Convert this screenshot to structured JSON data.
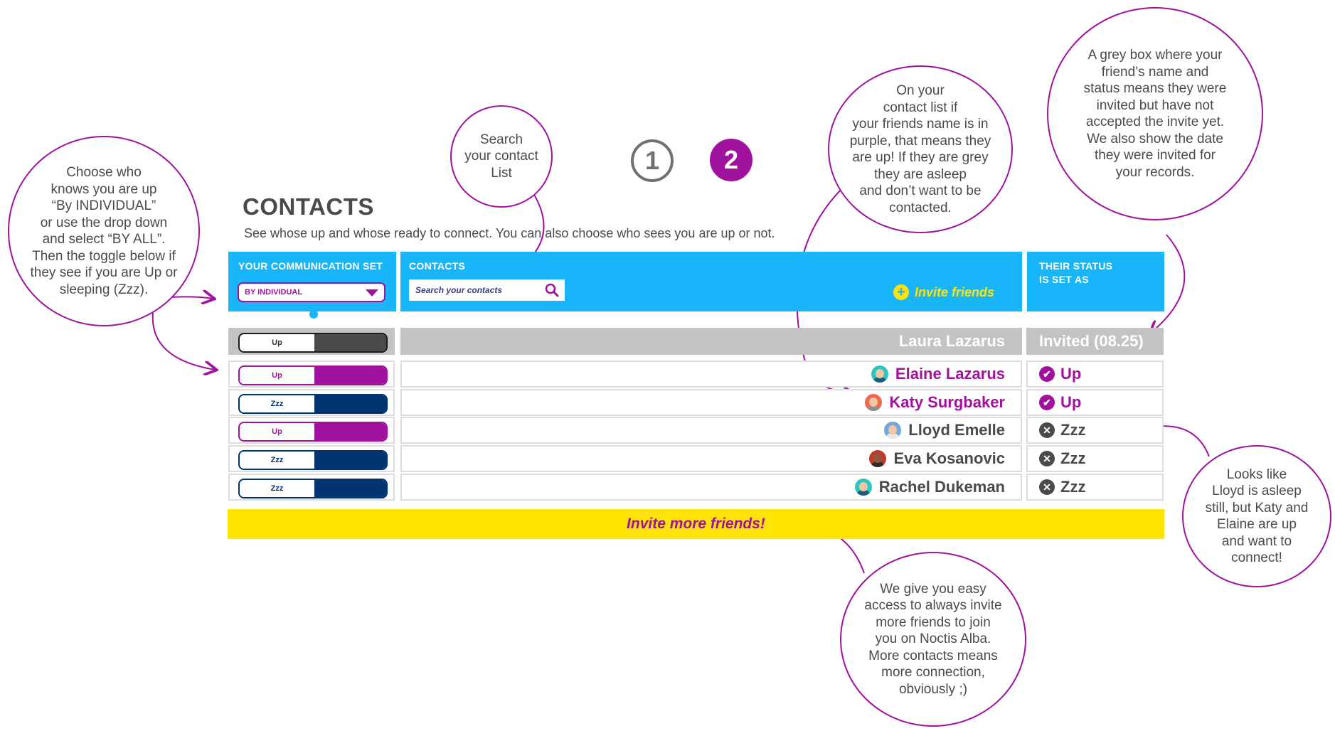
{
  "steps": [
    "1",
    "2"
  ],
  "page": {
    "title": "CONTACTS",
    "subtitle": "See whose up and whose ready to connect. You can also choose who sees you are up or not."
  },
  "header": {
    "communication_set_label": "YOUR COMMUNICATION SET",
    "dropdown_value": "BY INDIVIDUAL",
    "contacts_label": "CONTACTS",
    "search_placeholder": "Search your contacts",
    "invite_friends": "Invite friends",
    "status_label": "THEIR STATUS\nIS SET AS"
  },
  "pending_row": {
    "toggle": "Up",
    "name": "Laura Lazarus",
    "status": "Invited (08.25)"
  },
  "contacts": [
    {
      "toggle": "Up",
      "name": "Elaine Lazarus",
      "status": "Up",
      "status_icon": "check-circle-icon",
      "avatar_icon": "avatar-woman-teal-icon"
    },
    {
      "toggle": "Zzz",
      "name": "Katy Surgbaker",
      "status": "Up",
      "status_icon": "check-circle-icon",
      "avatar_icon": "avatar-woman-red-icon"
    },
    {
      "toggle": "Up",
      "name": "Lloyd Emelle",
      "status": "Zzz",
      "status_icon": "x-circle-icon",
      "avatar_icon": "avatar-man-blue-icon"
    },
    {
      "toggle": "Zzz",
      "name": "Eva Kosanovic",
      "status": "Zzz",
      "status_icon": "x-circle-icon",
      "avatar_icon": "avatar-woman-dark-icon"
    },
    {
      "toggle": "Zzz",
      "name": "Rachel Dukeman",
      "status": "Zzz",
      "status_icon": "x-circle-icon",
      "avatar_icon": "avatar-woman-teal-icon"
    }
  ],
  "invite_more": "Invite more friends!",
  "annotations": {
    "choose_who": "Choose who\nknows you are up\n“By INDIVIDUAL”\nor use the drop down\nand select “BY ALL”.\nThen the toggle below if\nthey see if you are Up or\nsleeping (Zzz).",
    "search": "Search\nyour contact\nList",
    "contact_list": "On your\ncontact list if\nyour friends name is in\npurple, that means they\nare up! If they are grey\nthey are asleep\nand don’t want to be\ncontacted.",
    "grey_box": "A grey box where your\nfriend’s name and\nstatus means they were\ninvited but have not\naccepted the invite yet.\nWe also show the date\nthey were invited for\nyour records.",
    "looks_like": "Looks like\nLloyd is asleep\nstill, but Katy and\nElaine are up\nand want to\nconnect!",
    "invite_access": "We give you easy\naccess to always invite\nmore friends to join\nyou on Noctis Alba.\nMore contacts means\nmore connection,\nobviously ;)"
  },
  "colors": {
    "purple": "#a0129e",
    "blue": "#19b5fb",
    "navy": "#003471",
    "yellow": "#ffe400",
    "grey_row": "#c3c3c3",
    "grey_text": "#4a4a4a",
    "dark_toggle": "#4b4b4b"
  }
}
